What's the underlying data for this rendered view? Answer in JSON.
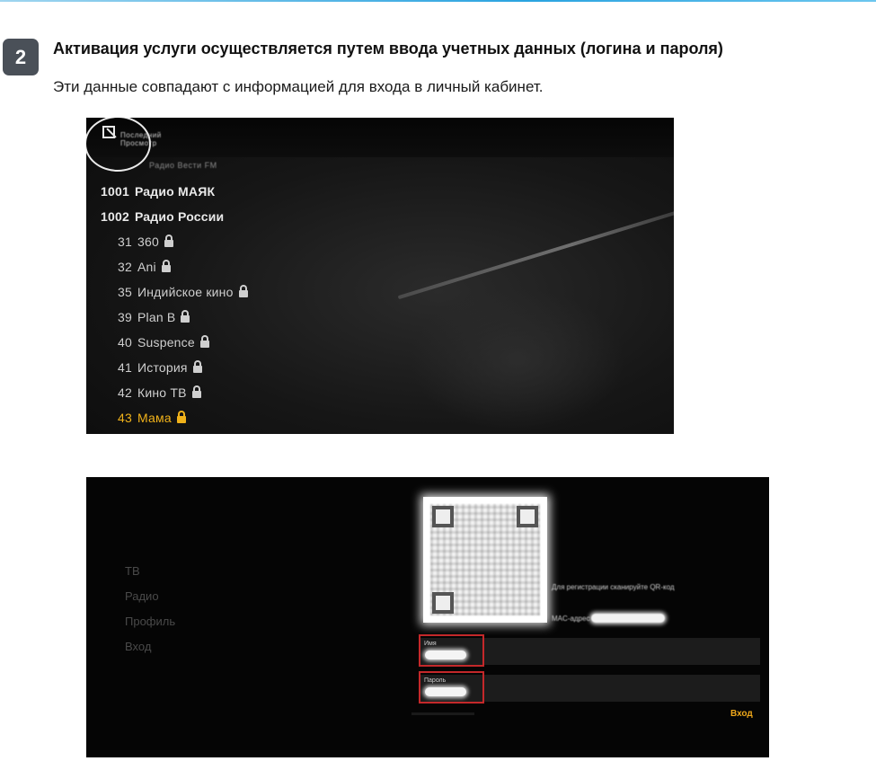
{
  "step": {
    "number": "2",
    "heading": "Активация услуги осуществляется путем ввода учетных данных (логина и пароля)",
    "subtext": "Эти данные совпадают с информацией для входа в личный кабинет."
  },
  "channel_screen": {
    "top_labels": [
      "Последний",
      "Просмотр",
      "Радио Вести FM"
    ],
    "channels": [
      {
        "number": "1001",
        "name": "Радио МАЯК",
        "locked": false
      },
      {
        "number": "1002",
        "name": "Радио России",
        "locked": false
      },
      {
        "number": "31",
        "name": "360",
        "locked": true
      },
      {
        "number": "32",
        "name": "Ani",
        "locked": true
      },
      {
        "number": "35",
        "name": "Индийское кино",
        "locked": true
      },
      {
        "number": "39",
        "name": "Plan B",
        "locked": true
      },
      {
        "number": "40",
        "name": "Suspence",
        "locked": true
      },
      {
        "number": "41",
        "name": "История",
        "locked": true
      },
      {
        "number": "42",
        "name": "Кино ТВ",
        "locked": true
      },
      {
        "number": "43",
        "name": "Мама",
        "locked": true
      }
    ],
    "accent_color": "#f0b21a"
  },
  "login_screen": {
    "menu": [
      "ТВ",
      "Радио",
      "Профиль",
      "Вход"
    ],
    "qr_hint": "Для регистрации сканируйте QR-код",
    "mac_label": "MAC-адрес",
    "login_label": "Имя",
    "password_label": "Пароль",
    "enter_label": "Вход",
    "highlight_color": "#c4282a",
    "enter_color": "#f0a81a"
  }
}
